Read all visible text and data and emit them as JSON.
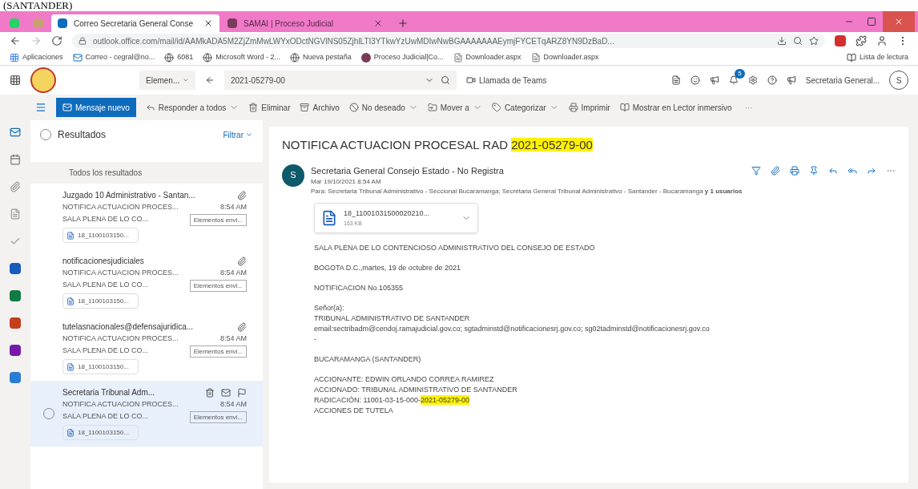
{
  "caption": "(SANTANDER)",
  "browser": {
    "tabs": [
      {
        "kind": "pinned",
        "selected": false,
        "color": "#25d366"
      },
      {
        "kind": "pinned",
        "selected": false,
        "color": "#c9a070"
      },
      {
        "kind": "page",
        "title": "Correo Secretaria General Conse",
        "selected": true,
        "color": "#0f6cbd"
      },
      {
        "kind": "page",
        "title": "SAMAI | Proceso Judicial",
        "selected": false,
        "color": "#7a3a5a"
      }
    ],
    "url": "outlook.office.com/mail/id/AAMkADA5M2ZjZmMwLWYxODctNGVlNS05ZjhlLTI3YTkwYzUwMDIwNwBGAAAAAAAEymjFYCETqARZ8YN9DzBaD...",
    "bookmarks": [
      {
        "kind": "apps",
        "label": "Aplicaciones"
      },
      {
        "kind": "outlook",
        "label": "Correo - cegral@no..."
      },
      {
        "kind": "globe",
        "label": "6081"
      },
      {
        "kind": "globe",
        "label": "Microsoft Word - 2..."
      },
      {
        "kind": "globe",
        "label": "Nueva pestaña"
      },
      {
        "kind": "samai",
        "label": "Proceso Judicial|Co..."
      },
      {
        "kind": "file",
        "label": "Downloader.aspx"
      },
      {
        "kind": "file",
        "label": "Downloader.aspx"
      }
    ],
    "reading_list": "Lista de lectura"
  },
  "header": {
    "folder": "Elemen...",
    "search": "2021-05279-00",
    "teams": "Llamada de Teams",
    "account": "Secretaria General...",
    "avatar": "S",
    "notifications": "5"
  },
  "toolbar": [
    {
      "kind": "primary",
      "label": "Mensaje nuevo"
    },
    {
      "kind": "action",
      "label": "Responder a todos",
      "dropdown": true
    },
    {
      "kind": "action",
      "label": "Eliminar",
      "dropdown": false
    },
    {
      "kind": "action",
      "label": "Archivo",
      "dropdown": false
    },
    {
      "kind": "action",
      "label": "No deseado",
      "dropdown": true
    },
    {
      "kind": "action",
      "label": "Mover a",
      "dropdown": true
    },
    {
      "kind": "action",
      "label": "Categorizar",
      "dropdown": true
    },
    {
      "kind": "action",
      "label": "Imprimir",
      "dropdown": false
    },
    {
      "kind": "action",
      "label": "Mostrar en Lector inmersivo",
      "dropdown": false
    },
    {
      "kind": "more",
      "label": "···"
    }
  ],
  "list": {
    "select_all_checked": false,
    "title": "Resultados",
    "filter": "Filtrar",
    "section": "Todos los resultados",
    "items": [
      {
        "sender": "Juzgado 10 Administrativo - Santan...",
        "subject": "NOTIFICA ACTUACION PROCES...",
        "time": "8:54 AM",
        "preview": "SALA PLENA DE LO CO...",
        "tag": "Elementos envi...",
        "attachment": "18_1100103150...",
        "selected": false
      },
      {
        "sender": "notificacionesjudiciales",
        "subject": "NOTIFICA ACTUACION PROCES...",
        "time": "8:54 AM",
        "preview": "SALA PLENA DE LO CO...",
        "tag": "Elementos envi...",
        "attachment": "18_1100103150...",
        "selected": false
      },
      {
        "sender": "tutelasnacionales@defensajuridica...",
        "subject": "NOTIFICA ACTUACION PROCES...",
        "time": "8:54 AM",
        "preview": "SALA PLENA DE LO CO...",
        "tag": "Elementos envi...",
        "attachment": "18_1100103150...",
        "selected": false
      },
      {
        "sender": "Secretaria Tribunal Adm...",
        "subject": "NOTIFICA ACTUACION PROCES...",
        "time": "8:54 AM",
        "preview": "SALA PLENA DE LO CO...",
        "tag": "Elementos envi...",
        "attachment": "18_1100103150...",
        "selected": true
      }
    ]
  },
  "message": {
    "subject": "NOTIFICA ACTUACION PROCESAL RAD ",
    "subject_highlight": "2021-05279-00",
    "avatar": "S",
    "sender": "Secretaria General Consejo Estado - No Registra",
    "date": "Mar 19/10/2021 8:54 AM",
    "to": "Para: Secretaria Tribunal Administrativo - Seccional Bucaramanga; Secretaria General Tribunal Administrativo - Santander - Bucaramanga **y 1 usuarios**",
    "attachment": {
      "name": "18_11001031500020210...",
      "size": "163 KB"
    },
    "paragraphs": [
      [
        {
          "text": "SALA PLENA DE LO CONTENCIOSO ADMINISTRATIVO DEL CONSEJO DE ESTADO"
        }
      ],
      [
        {
          "text": "BOGOTA D.C.,martes, 19 de octubre de 2021"
        }
      ],
      [
        {
          "text": "NOTIFICACION No.105355"
        }
      ],
      [
        {
          "text": "Señor(a):"
        },
        {
          "text": "TRIBUNAL ADMINISTRATIVO DE SANTANDER"
        },
        {
          "text": "email:sectribadm@cendoj.ramajudicial.gov.co; sgtadminstd@notificacionesrj.gov.co; sg02tadminstd@notificacionesrj.gov.co"
        },
        {
          "text": "-"
        }
      ],
      [
        {
          "text": "BUCARAMANGA (SANTANDER)"
        }
      ],
      [
        {
          "text": "ACCIONANTE: EDWIN ORLANDO CORREA RAMIREZ"
        },
        {
          "text": "ACCIONADO: TRIBUNAL ADMINISTRATIVO DE SANTANDER"
        },
        {
          "text": "RADICACIÓN: 11001-03-15-000-",
          "highlight": "2021-05279-00"
        },
        {
          "text": "ACCIONES DE TUTELA"
        }
      ]
    ]
  }
}
